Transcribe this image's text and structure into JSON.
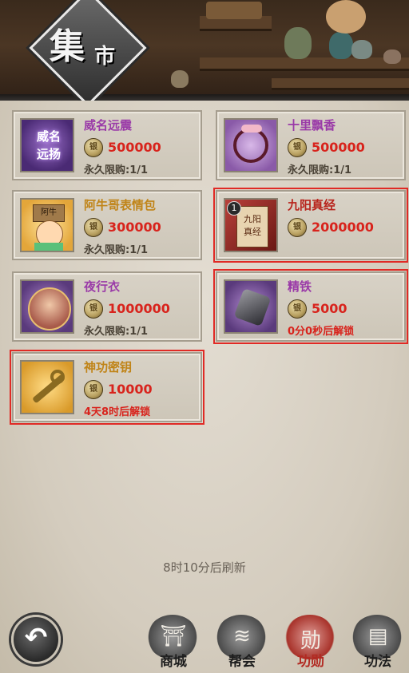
{
  "header": {
    "title_main": "集",
    "title_sub": "市"
  },
  "items": [
    {
      "name": "威名远震",
      "name_color": "#9a3aa8",
      "thumb_text": "威名\n远扬",
      "price": "500000",
      "footer": "永久限购:1/1",
      "footer_type": "limit",
      "selected": false,
      "badge": ""
    },
    {
      "name": "十里飘香",
      "name_color": "#9a3aa8",
      "thumb_text": "",
      "price": "500000",
      "footer": "永久限购:1/1",
      "footer_type": "limit",
      "selected": false,
      "badge": ""
    },
    {
      "name": "阿牛哥表情包",
      "name_color": "#c08418",
      "thumb_text": "阿牛",
      "price": "300000",
      "footer": "永久限购:1/1",
      "footer_type": "limit",
      "selected": false,
      "badge": ""
    },
    {
      "name": "九阳真经",
      "name_color": "#b8241c",
      "thumb_text": "九阳\n真经",
      "price": "2000000",
      "footer": "",
      "footer_type": "none",
      "selected": true,
      "badge": "1"
    },
    {
      "name": "夜行衣",
      "name_color": "#9a3aa8",
      "thumb_text": "",
      "price": "1000000",
      "footer": "永久限购:1/1",
      "footer_type": "limit",
      "selected": false,
      "badge": ""
    },
    {
      "name": "精铁",
      "name_color": "#9a3aa8",
      "thumb_text": "",
      "price": "5000",
      "footer": "0分0秒后解锁",
      "footer_type": "unlock",
      "selected": true,
      "badge": ""
    },
    {
      "name": "神功密钥",
      "name_color": "#c08418",
      "thumb_text": "",
      "price": "10000",
      "footer": "4天8时后解锁",
      "footer_type": "unlock",
      "selected": true,
      "badge": ""
    }
  ],
  "coin_glyph": "银",
  "refresh_text": "8时10分后刷新",
  "back_glyph": "↶",
  "tabs": [
    {
      "label": "商城",
      "glyph": "⛩",
      "active": false
    },
    {
      "label": "帮会",
      "glyph": "≋",
      "active": false
    },
    {
      "label": "功勋",
      "glyph": "勋",
      "active": true
    },
    {
      "label": "功法",
      "glyph": "▤",
      "active": false
    }
  ],
  "colors": {
    "price": "#d8231c",
    "selection_outline": "#e02a25",
    "active_tab": "#b22a22"
  }
}
